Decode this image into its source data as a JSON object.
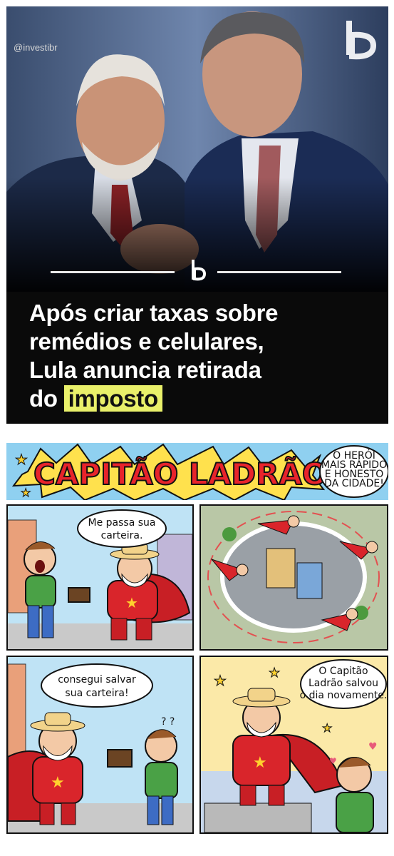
{
  "news": {
    "handle": "@investibr",
    "headline_lines": [
      "Após criar taxas sobre",
      "remédios e celulares,",
      "Lula anuncia retirada"
    ],
    "headline_last_prefix": "do",
    "headline_highlight": "imposto",
    "brand_color": "#e9f06a"
  },
  "comic": {
    "title": "CAPITÃO LADRÃO",
    "tagline_lines": [
      "O HERÓI",
      "MAIS RÁPIDO",
      "E HONESTO",
      "DA CIDADE!"
    ],
    "panel1_bubble": [
      "Me passa sua",
      "carteira."
    ],
    "panel3_bubble": [
      "consegui salvar",
      "sua carteira!"
    ],
    "panel3_marks": "? ?",
    "panel4_bubble": [
      "O Capitão",
      "Ladrão salvou",
      "o dia novamente."
    ],
    "colors": {
      "title_fill": "#e8242b",
      "burst": "#ffe14d",
      "sky": "#9ed2f0",
      "hero_suit": "#d9252b",
      "star": "#ffd12e"
    }
  }
}
